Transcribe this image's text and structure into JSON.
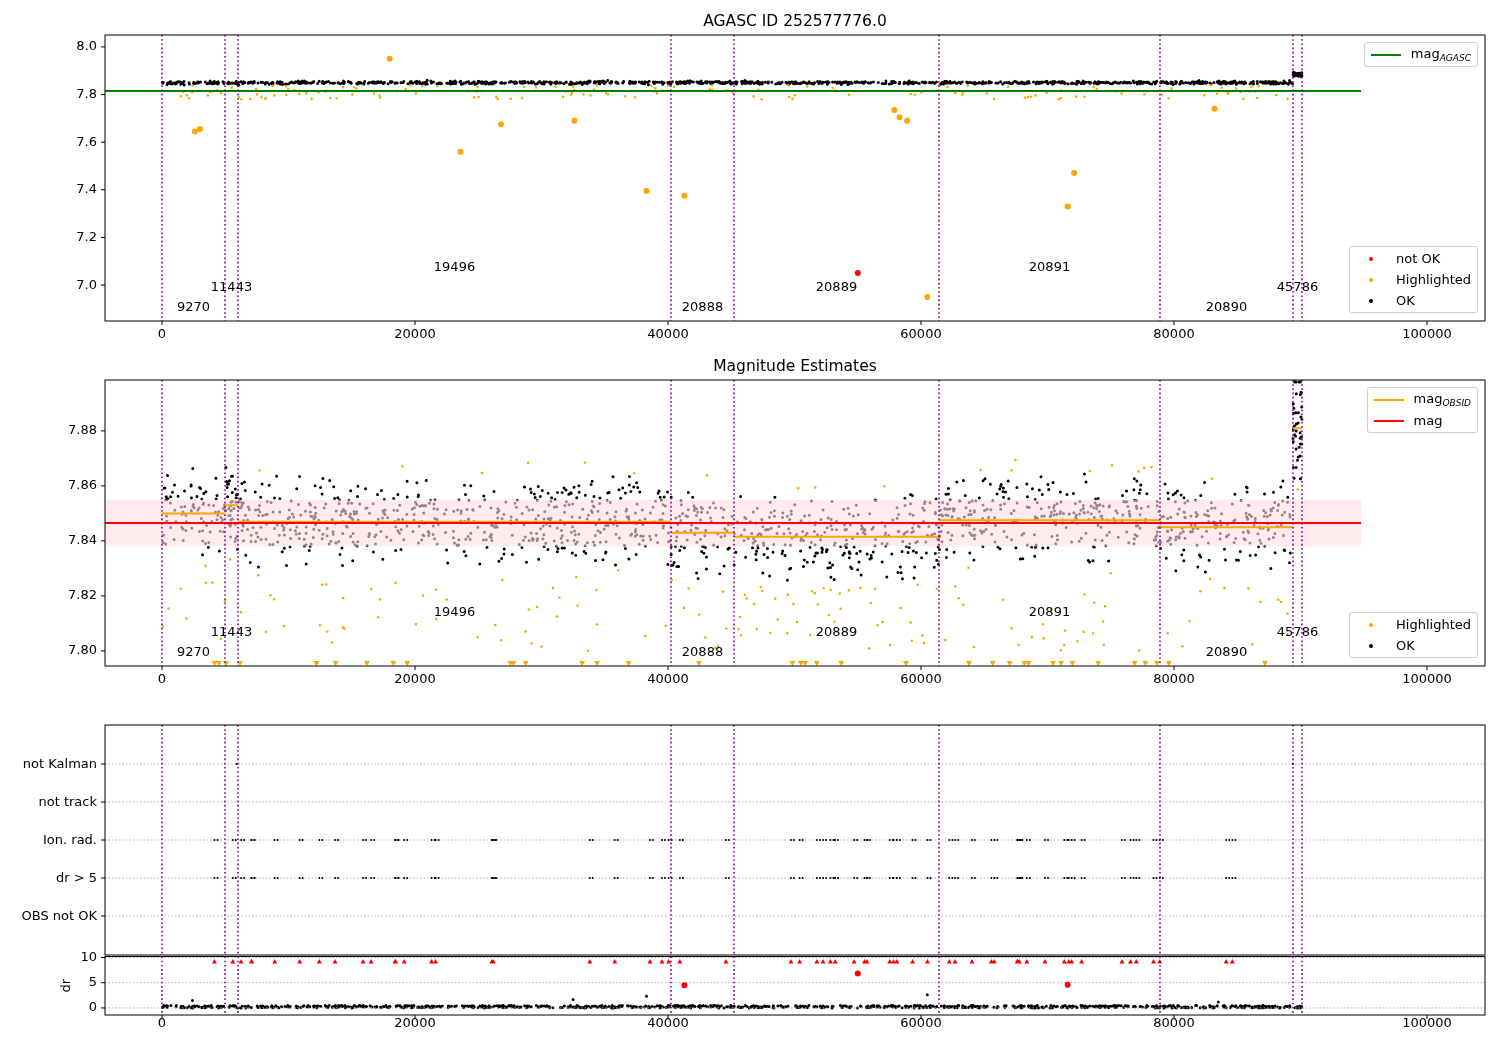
{
  "figure": {
    "panels": [
      {
        "kind": "magnitude",
        "chart_data": {
          "type": "scatter",
          "title": "AGASC ID 252577776.0",
          "xlim": [
            -4506,
            104585
          ],
          "ylim": [
            6.849,
            8.05
          ],
          "xticks": [
            {
              "value": 0,
              "label": "0"
            },
            {
              "value": 20000,
              "label": "20000"
            },
            {
              "value": 40000,
              "label": "40000"
            },
            {
              "value": 60000,
              "label": "60000"
            },
            {
              "value": 80000,
              "label": "80000"
            },
            {
              "value": 100000,
              "label": "100000"
            }
          ],
          "yticks": [
            {
              "value": 7.0,
              "label": "7.0"
            },
            {
              "value": 7.2,
              "label": "7.2"
            },
            {
              "value": 7.4,
              "label": "7.4"
            },
            {
              "value": 7.6,
              "label": "7.6"
            },
            {
              "value": 7.8,
              "label": "7.8"
            },
            {
              "value": 8.0,
              "label": "8.0"
            }
          ],
          "series": [
            {
              "type": "line",
              "color": "#008000",
              "x": [
                -4506,
                94783
              ],
              "values": [
                7.815,
                7.815
              ]
            },
            {
              "color": "#ff0000",
              "x": [
                55000
              ],
              "values": [
                7.05
              ]
            },
            {
              "color": "#ffa500",
              "x": [
                2600,
                3000,
                18000,
                23600,
                26800,
                32600,
                38300,
                41300,
                57900,
                58300,
                58900,
                60500,
                71600,
                72100,
                83200
              ],
              "values": [
                7.645,
                7.655,
                7.95,
                7.56,
                7.675,
                7.69,
                7.395,
                7.375,
                7.735,
                7.705,
                7.69,
                6.95,
                7.33,
                7.47,
                7.74
              ]
            }
          ],
          "ref_lines": [
            {
              "axis": "x",
              "value": 0
            },
            {
              "axis": "x",
              "value": 4980
            },
            {
              "axis": "x",
              "value": 6008
            },
            {
              "axis": "x",
              "value": 40237
            },
            {
              "axis": "x",
              "value": 45217
            },
            {
              "axis": "x",
              "value": 61423
            },
            {
              "axis": "x",
              "value": 78893
            },
            {
              "axis": "x",
              "value": 89407
            },
            {
              "axis": "x",
              "value": 90119
            }
          ],
          "annotations": [
            "9270",
            "11443",
            "19496",
            "20888",
            "20889",
            "20891",
            "20890",
            "45786"
          ]
        },
        "legends": [
          {
            "entries": [
              {
                "label": "mag$_{AGASC}$",
                "kind": "line",
                "color": "#008000"
              }
            ]
          },
          {
            "entries": [
              {
                "label": "not OK",
                "kind": "dot",
                "color": "#ff0000"
              },
              {
                "label": "Highlighted",
                "kind": "dot",
                "color": "#ffa500"
              },
              {
                "label": "OK",
                "kind": "dot",
                "color": "#000000"
              }
            ]
          }
        ]
      },
      {
        "kind": "estimates",
        "chart_data": {
          "type": "line",
          "title": "Magnitude Estimates",
          "xlim": [
            -4506,
            104585
          ],
          "ylim": [
            7.7945,
            7.8985
          ],
          "xticks": [
            {
              "value": 0,
              "label": "0"
            },
            {
              "value": 20000,
              "label": "20000"
            },
            {
              "value": 40000,
              "label": "40000"
            },
            {
              "value": 60000,
              "label": "60000"
            },
            {
              "value": 80000,
              "label": "80000"
            },
            {
              "value": 100000,
              "label": "100000"
            }
          ],
          "yticks": [
            {
              "value": 7.8,
              "label": "7.80"
            },
            {
              "value": 7.82,
              "label": "7.82"
            },
            {
              "value": 7.84,
              "label": "7.84"
            },
            {
              "value": 7.86,
              "label": "7.86"
            },
            {
              "value": 7.88,
              "label": "7.88"
            }
          ],
          "bands": [
            {
              "axis": "y",
              "from": 7.838,
              "to": 7.855,
              "color": "#ffdde1"
            }
          ],
          "series": [
            {
              "color": "#ffa500",
              "x": [
                0,
                4980,
                4980,
                6008,
                6008,
                40237,
                40237,
                45217,
                45217,
                61423,
                61423,
                78893,
                78893,
                89407,
                89407,
                90119
              ],
              "values": [
                7.85,
                7.85,
                7.853,
                7.853,
                7.847,
                7.847,
                7.843,
                7.843,
                7.8415,
                7.8415,
                7.8475,
                7.8475,
                7.845,
                7.845,
                7.881,
                7.881
              ]
            },
            {
              "color": "#ff0000",
              "x": [
                -4506,
                94783
              ],
              "values": [
                7.8465,
                7.8465
              ]
            }
          ],
          "ref_lines": [
            {
              "axis": "x",
              "value": 0
            },
            {
              "axis": "x",
              "value": 4980
            },
            {
              "axis": "x",
              "value": 6008
            },
            {
              "axis": "x",
              "value": 40237
            },
            {
              "axis": "x",
              "value": 45217
            },
            {
              "axis": "x",
              "value": 61423
            },
            {
              "axis": "x",
              "value": 78893
            },
            {
              "axis": "x",
              "value": 89407
            },
            {
              "axis": "x",
              "value": 90119
            }
          ],
          "annotations": [
            "9270",
            "11443",
            "19496",
            "20888",
            "20889",
            "20891",
            "20890",
            "45786"
          ]
        },
        "legends": [
          {
            "entries": [
              {
                "label": "mag$_{OBSID}$",
                "kind": "line",
                "color": "#ffa500"
              },
              {
                "label": "mag",
                "kind": "line",
                "color": "#ff0000"
              }
            ]
          },
          {
            "entries": [
              {
                "label": "Highlighted",
                "kind": "dot",
                "color": "#ffa500"
              },
              {
                "label": "OK",
                "kind": "dot",
                "color": "#000000"
              }
            ]
          }
        ]
      },
      {
        "kind": "flags",
        "row_labels": [
          "not Kalman",
          "not track",
          "Ion. rad.",
          "dr > 5",
          "OBS not OK"
        ]
      },
      {
        "kind": "dr",
        "chart_data": {
          "type": "scatter",
          "ylabel": "dr",
          "grid": true,
          "xlim": [
            -4506,
            104585
          ],
          "ylim": [
            -1.4,
            10.2
          ],
          "xticks": [
            {
              "value": 0,
              "label": "0"
            },
            {
              "value": 20000,
              "label": "20000"
            },
            {
              "value": 40000,
              "label": "40000"
            },
            {
              "value": 60000,
              "label": "60000"
            },
            {
              "value": 80000,
              "label": "80000"
            },
            {
              "value": 100000,
              "label": "100000"
            }
          ],
          "yticks": [
            {
              "value": 0,
              "label": "0"
            },
            {
              "value": 5,
              "label": "5"
            },
            {
              "value": 10,
              "label": "10"
            }
          ],
          "series": [
            {
              "color": "#ff0000",
              "x": [
                41300,
                55000,
                71600
              ],
              "values": [
                4.5,
                6.8,
                4.6
              ]
            }
          ],
          "ref_lines": [
            {
              "axis": "x",
              "value": 0
            },
            {
              "axis": "x",
              "value": 4980
            },
            {
              "axis": "x",
              "value": 6008
            },
            {
              "axis": "x",
              "value": 40237
            },
            {
              "axis": "x",
              "value": 45217
            },
            {
              "axis": "x",
              "value": 61423
            },
            {
              "axis": "x",
              "value": 78893
            },
            {
              "axis": "x",
              "value": 89407
            },
            {
              "axis": "x",
              "value": 90119
            }
          ]
        }
      }
    ]
  }
}
